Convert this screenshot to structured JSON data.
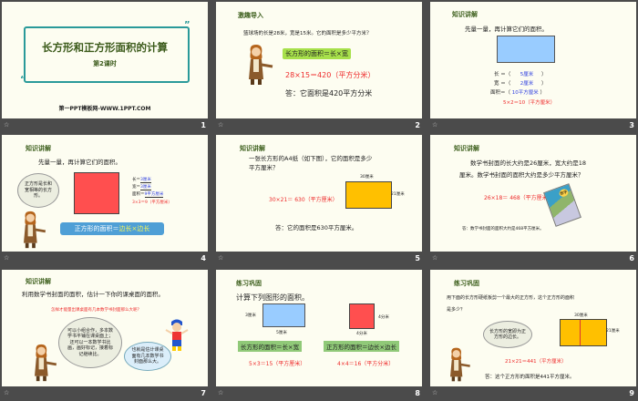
{
  "slides": [
    {
      "number": "1",
      "title": "长方形和正方形面积的计算",
      "subtitle": "第2课时",
      "footer": "第一PPT模板网-WWW.1PPT.COM"
    },
    {
      "number": "2",
      "header": "激趣导入",
      "question": "篮球场的长是28米，宽是15米。它的面积是多少平方米？",
      "formula": "长方形的面积＝长×宽",
      "equation": "28×15＝420（平方分米）",
      "answer": "答：它面积是420平方分米"
    },
    {
      "number": "3",
      "header": "知识讲解",
      "prompt": "先量一量，再计算它们的面积。",
      "length_label": "长 ＝（",
      "length": "5厘米",
      "width_label": "宽 ＝（",
      "width": "2厘米",
      "area_label": "面积＝（",
      "area": "10平方厘米",
      "close": "）",
      "equation": "5×2＝10（平方厘米）"
    },
    {
      "number": "4",
      "header": "知识讲解",
      "prompt": "先量一量，再计算它们的面积。",
      "bubble": "正方形是长和宽相等的长方形。",
      "length_label": "长＝",
      "length": "3厘米",
      "width_label": "宽＝",
      "width": "3厘米",
      "area_label": "面积＝",
      "area": "9平方厘米",
      "equation": "3×3＝9（平方厘米）",
      "formula_left": "正方形的面积＝",
      "formula_right": "边长×边长"
    },
    {
      "number": "5",
      "header": "知识讲解",
      "question": "一张长方形的A4纸（如下图），它的面积是多少平方厘米？",
      "equation": "30×21＝ 630（平方厘米）",
      "top_label": "30厘米",
      "side_label": "21厘米",
      "answer": "答：它的面积是630平方厘米。"
    },
    {
      "number": "6",
      "header": "知识讲解",
      "question_1": "数学书封面的长大约是26厘米，宽大约是18",
      "question_2": "厘米。数学书封面的面积大约是多少平方厘米？",
      "equation": "26×18＝ 468（平方厘米）",
      "book_title": "数学",
      "answer": "答：数学书封面的面积大约是468平方厘米。"
    },
    {
      "number": "7",
      "header": "知识讲解",
      "prompt": "利用数学书封面的面积，估计一下你的课桌面的面积。",
      "question": "怎样才能量出课桌面有几本数学书封面那么大呢？",
      "bubble_teacher": "可以小组合作，多本数学书平铺在课桌面上；还可以一本数学书比画，画好标记，接着标记继续比。",
      "bubble_kid": "也就是估计课桌面有几本数学书封面那么大。"
    },
    {
      "number": "8",
      "header": "练习巩固",
      "prompt": "计算下列图形的面积。",
      "rect_side": "3厘米",
      "rect_bottom": "5厘米",
      "rect_formula": "长方形的面积＝长×宽",
      "rect_equation": "5×3＝15（平方厘米）",
      "sq_side": "4分米",
      "sq_bottom": "4分米",
      "sq_formula": "正方形的面积＝边长×边长",
      "sq_equation": "4×4＝16（平方分米）"
    },
    {
      "number": "9",
      "header": "练习巩固",
      "question_1": "用下面的长方形硬纸板剪一个最大的正方形，这个正方形的面积",
      "question_2": "是多少？",
      "bubble": "长方形的宽即为正方形的边长。",
      "top_label": "30厘米",
      "side_label": "21厘米",
      "equation": "21×21＝441（平方厘米）",
      "answer": "答：这个正方形的面积是441平方厘米。"
    }
  ],
  "caption_icon": "star-icon"
}
